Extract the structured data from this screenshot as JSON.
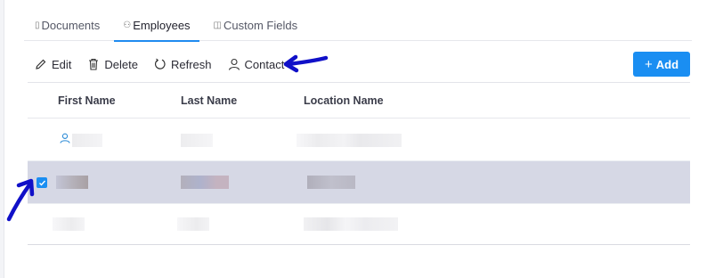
{
  "tabs": [
    {
      "label": "Documents",
      "icon": "document-icon",
      "active": false
    },
    {
      "label": "Employees",
      "icon": "people-icon",
      "active": true
    },
    {
      "label": "Custom Fields",
      "icon": "tag-icon",
      "active": false
    }
  ],
  "toolbar": {
    "edit_label": "Edit",
    "delete_label": "Delete",
    "refresh_label": "Refresh",
    "contact_label": "Contact",
    "add_label": "Add"
  },
  "table": {
    "columns": [
      "First Name",
      "Last Name",
      "Location Name"
    ]
  },
  "colors": {
    "accent": "#1a8ef2",
    "selected_row": "#d6d8e5",
    "annotation_arrow": "#1010c8"
  }
}
